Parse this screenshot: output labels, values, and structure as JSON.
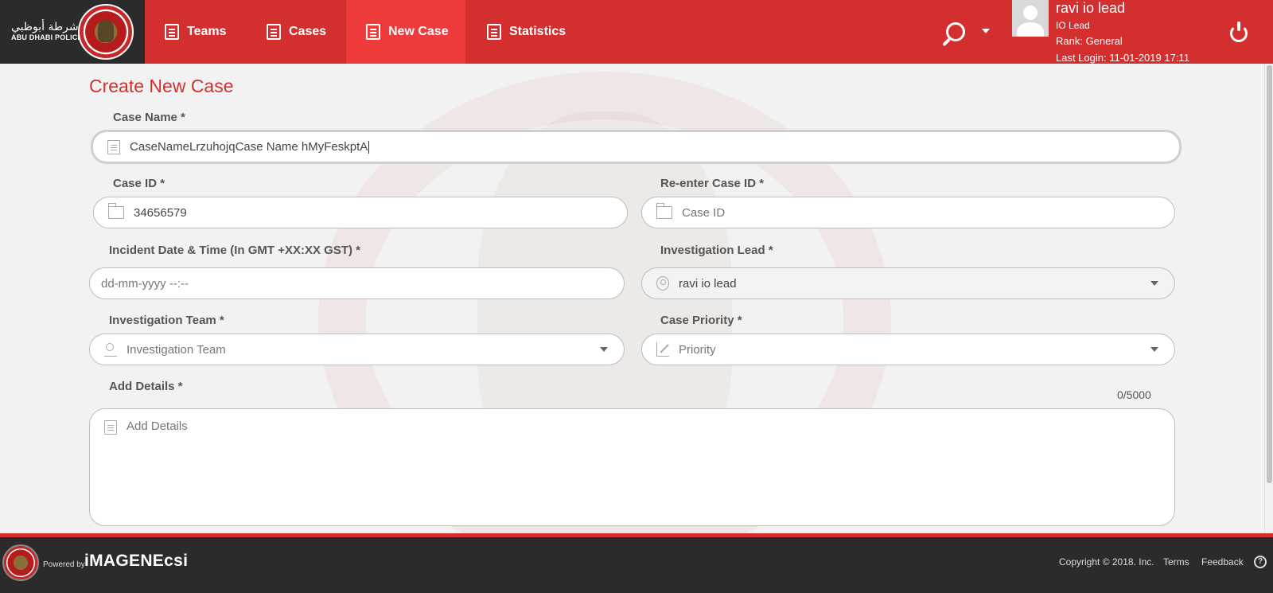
{
  "header": {
    "logo_arabic": "شرطة أبوظبي",
    "logo_english": "ABU DHABI POLICE",
    "nav": [
      {
        "label": "Teams",
        "icon": "list-icon"
      },
      {
        "label": "Cases",
        "icon": "list-icon"
      },
      {
        "label": "New Case",
        "icon": "document-icon",
        "active": true
      },
      {
        "label": "Statistics",
        "icon": "document-icon"
      }
    ],
    "user": {
      "name": "ravi io lead",
      "role": "IO Lead",
      "rank": "Rank: General",
      "last_login": "Last Login: 11-01-2019 17:11"
    },
    "accent_color": "#d32f2f",
    "active_tab_color": "#ef3b3b"
  },
  "form": {
    "title": "Create New Case",
    "case_name": {
      "label": "Case Name *",
      "value": "CaseNameLrzuhojqCase Name hMyFeskptA"
    },
    "case_id": {
      "label": "Case ID *",
      "value": "34656579"
    },
    "reenter_case_id": {
      "label": "Re-enter Case ID *",
      "placeholder": "Case ID"
    },
    "incident_datetime": {
      "label": "Incident Date & Time (In GMT +XX:XX GST) *",
      "placeholder": "dd-mm-yyyy --:--"
    },
    "investigation_lead": {
      "label": "Investigation Lead *",
      "value": "ravi io lead"
    },
    "investigation_team": {
      "label": "Investigation Team *",
      "placeholder": "Investigation Team"
    },
    "case_priority": {
      "label": "Case Priority *",
      "placeholder": "Priority"
    },
    "details": {
      "label": "Add Details *",
      "placeholder": "Add Details",
      "counter": "0/5000"
    }
  },
  "footer": {
    "powered_by": "Powered by",
    "brand": "iMAGENEcsi",
    "copyright": "Copyright © 2018. Inc.",
    "links": [
      "Terms",
      "Feedback"
    ],
    "help": "?"
  }
}
